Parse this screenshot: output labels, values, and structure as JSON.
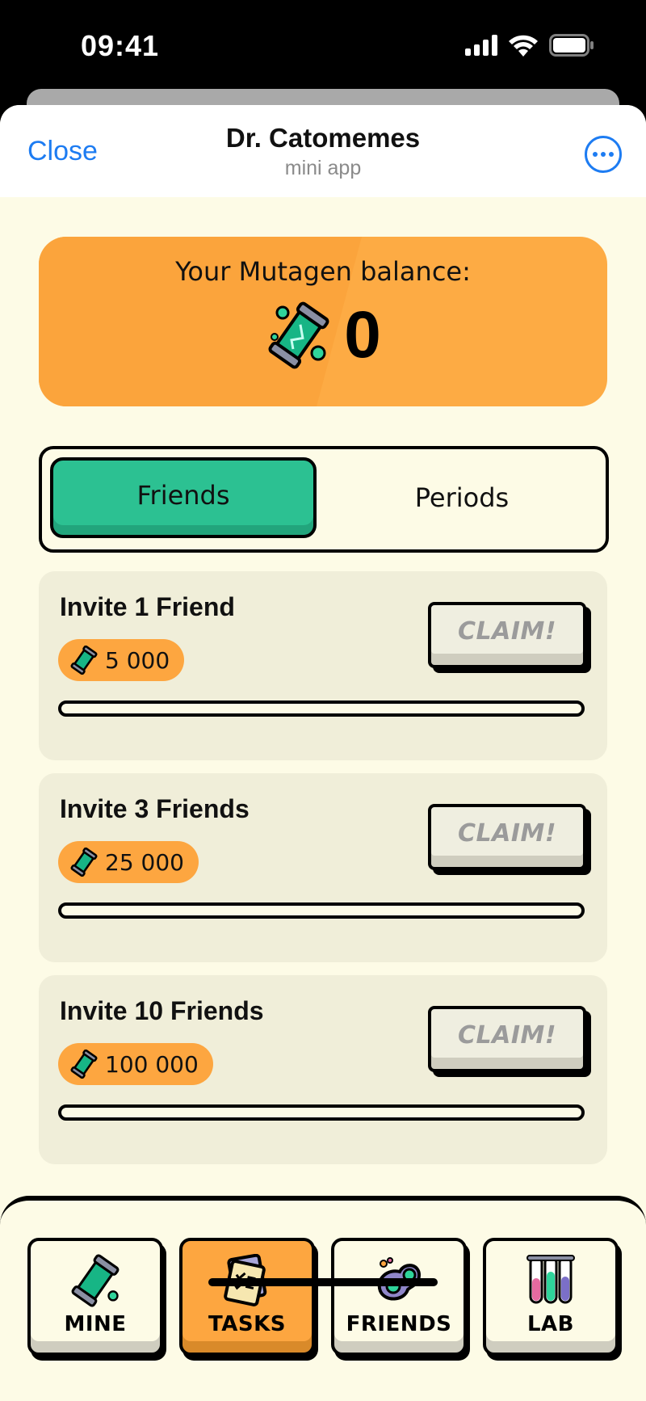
{
  "status_bar": {
    "time": "09:41"
  },
  "header": {
    "close_label": "Close",
    "title": "Dr. Catomemes",
    "subtitle": "mini app"
  },
  "balance": {
    "label": "Your Mutagen balance:",
    "value": "0"
  },
  "tabs": [
    {
      "label": "Friends",
      "active": true
    },
    {
      "label": "Periods",
      "active": false
    }
  ],
  "tasks": [
    {
      "title": "Invite 1 Friend",
      "reward": "5 000",
      "claim_label": "CLAIM!",
      "progress": 0
    },
    {
      "title": "Invite 3 Friends",
      "reward": "25 000",
      "claim_label": "CLAIM!",
      "progress": 0
    },
    {
      "title": "Invite 10 Friends",
      "reward": "100 000",
      "claim_label": "CLAIM!",
      "progress": 0
    }
  ],
  "nav": [
    {
      "label": "MINE",
      "icon": "mutagen-capsule-icon",
      "active": false
    },
    {
      "label": "TASKS",
      "icon": "task-list-icon",
      "active": true
    },
    {
      "label": "FRIENDS",
      "icon": "friends-cell-icon",
      "active": false
    },
    {
      "label": "LAB",
      "icon": "test-tubes-icon",
      "active": false
    }
  ],
  "colors": {
    "accent_orange": "#fda640",
    "accent_green": "#2cc192",
    "link_blue": "#1d7cf2",
    "background": "#fdfbe6"
  }
}
